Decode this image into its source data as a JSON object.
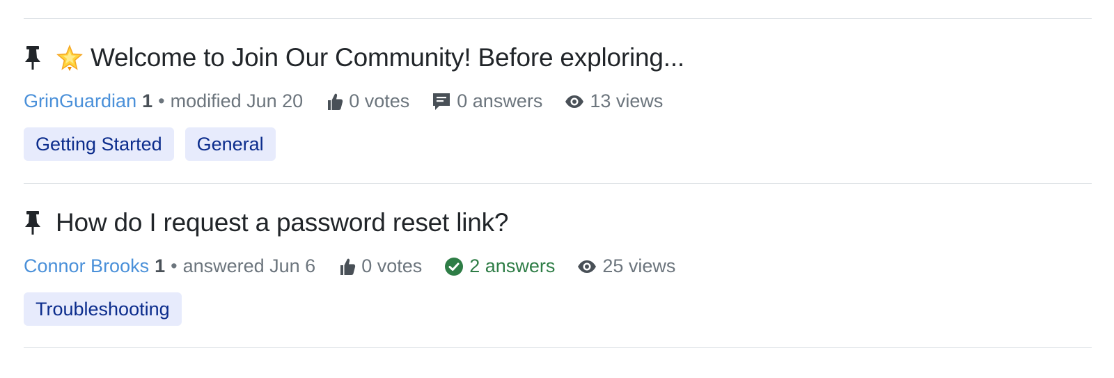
{
  "questions": [
    {
      "pinned": true,
      "emoji": "star-icon",
      "title": "Welcome to Join Our Community! Before exploring...",
      "author": "GrinGuardian",
      "reputation": "1",
      "separator": "•",
      "activity": "modified Jun 20",
      "votes": "0 votes",
      "answers": "0 answers",
      "answers_accepted": false,
      "views": "13 views",
      "tags": [
        "Getting Started",
        "General"
      ]
    },
    {
      "pinned": true,
      "title": "How do I request a password reset link?",
      "author": "Connor Brooks",
      "reputation": "1",
      "separator": "•",
      "activity": "answered Jun 6",
      "votes": "0 votes",
      "answers": "2 answers",
      "answers_accepted": true,
      "views": "25 views",
      "tags": [
        "Troubleshooting"
      ]
    }
  ],
  "colors": {
    "author_link": "#4a90d9",
    "accepted_green": "#2e7d46",
    "tag_bg": "#e7ebfc",
    "tag_text": "#0b2c8c",
    "muted": "#6c757d"
  }
}
